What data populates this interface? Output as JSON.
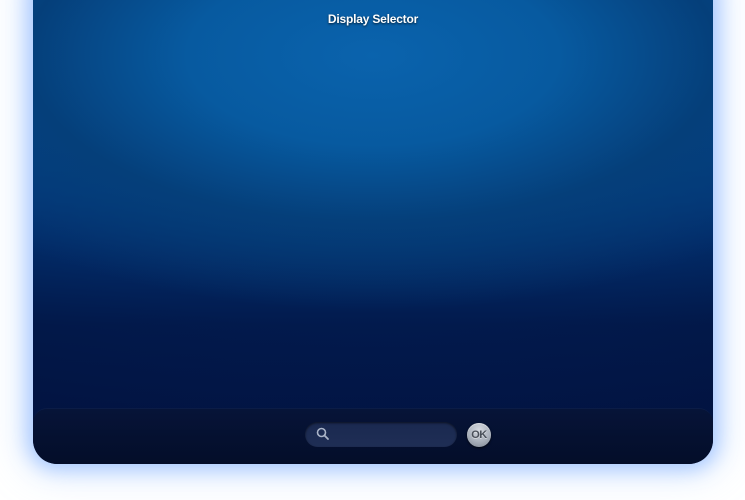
{
  "window": {
    "title": "Display Selector"
  },
  "search": {
    "value": "",
    "placeholder": "",
    "icon": "search-icon"
  },
  "ok_button": {
    "label": "OK"
  },
  "colors": {
    "background_top": "#075aa0",
    "background_bottom": "#011548",
    "bottom_bar": "#040d29",
    "glow": "#78aaff",
    "button": "#a9b0bb"
  }
}
